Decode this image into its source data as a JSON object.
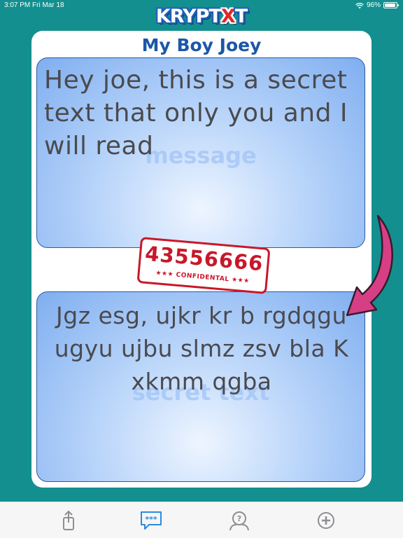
{
  "status_bar": {
    "time": "3:07 PM",
    "date": "Fri Mar 18",
    "battery_text": "96%",
    "battery_level": 0.96
  },
  "header": {
    "logo_main": "KRYPT",
    "logo_accent": "X",
    "logo_end": "T",
    "contact_name": "My Boy Joey"
  },
  "message_box": {
    "watermark": "message",
    "text": "Hey joe, this is a secret text that only you and I will read"
  },
  "stamp": {
    "code": "43556666",
    "label": "★★★ CONFIDENTAL ★★★"
  },
  "secret_box": {
    "watermark": "secret text",
    "text": "Jgz esg, ujkr kr b rgdqgu ugyu ujbu slmz zsv bla K xkmm qgba"
  },
  "tab_bar": {
    "items": [
      {
        "icon": "share-icon"
      },
      {
        "icon": "chat-bubble-icon"
      },
      {
        "icon": "faq-icon"
      },
      {
        "icon": "add-circle-icon"
      }
    ],
    "active_color": "#2a8be0",
    "inactive_color": "#8e8e93"
  },
  "colors": {
    "background": "#138f8f",
    "title": "#1b57a8",
    "stamp": "#c8182a",
    "arrow": "#d63f86"
  }
}
